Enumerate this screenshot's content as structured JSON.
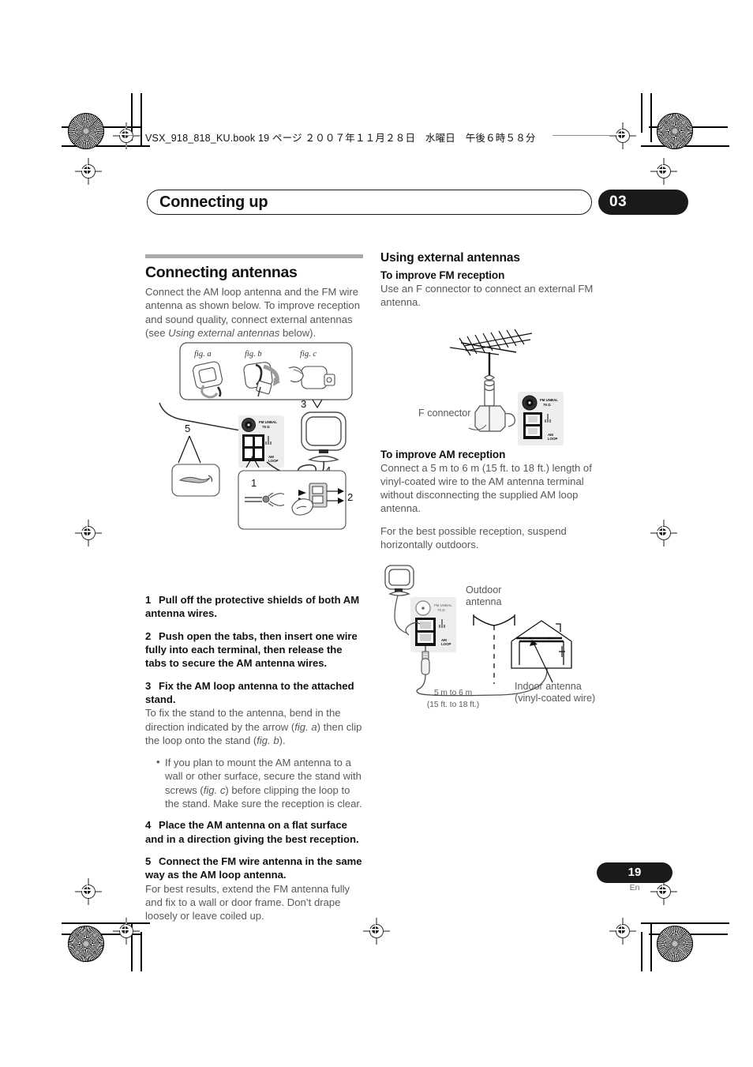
{
  "print": {
    "filename_line": "VSX_918_818_KU.book  19 ページ  ２００７年１１月２８日　水曜日　午後６時５８分"
  },
  "header": {
    "chapter_title": "Connecting up",
    "chapter_number": "03"
  },
  "left_column": {
    "section_title": "Connecting antennas",
    "intro_part1": "Connect the AM loop antenna and the FM wire antenna as shown below. To improve reception and sound quality, connect external antennas (see ",
    "intro_italic": "Using external antennas",
    "intro_part2": " below).",
    "steps": [
      {
        "num": "1",
        "text": "Pull off the protective shields of both AM antenna wires."
      },
      {
        "num": "2",
        "text": "Push open the tabs, then insert one wire fully into each terminal, then release the tabs to secure the AM antenna wires."
      },
      {
        "num": "3",
        "text": "Fix the AM loop antenna to the attached stand."
      },
      {
        "num": "4",
        "text": "Place the AM antenna on a flat surface and in a direction giving the best reception."
      },
      {
        "num": "5",
        "text": "Connect the FM wire antenna in the same way as the AM loop antenna."
      }
    ],
    "step3_body_a": "To fix the stand to the antenna, bend in the direction indicated by the arrow (",
    "step3_body_it1": "fig. a",
    "step3_body_b": ") then clip the loop onto the stand (",
    "step3_body_it2": "fig. b",
    "step3_body_c": ").",
    "bullet_a": "If you plan to mount the AM antenna to a wall or other surface, secure the stand with screws (",
    "bullet_it": "fig. c",
    "bullet_b": ") before clipping the loop to the stand. Make sure the reception is clear.",
    "step5_body": "For best results, extend the FM antenna fully and fix to a wall or door frame. Don’t drape loosely or leave coiled up."
  },
  "right_column": {
    "section_title": "Using external antennas",
    "fm_heading": "To improve FM reception",
    "fm_body": "Use an F connector to connect an external FM antenna.",
    "am_heading": "To improve AM reception",
    "am_body_1": "Connect a 5 m to 6 m (15 ft. to 18 ft.) length of vinyl-coated wire to the AM antenna terminal without disconnecting the supplied AM loop antenna.",
    "am_body_2": "For the best possible reception, suspend horizontally outdoors."
  },
  "figures": {
    "fig_box": {
      "label_a": "fig. a",
      "label_b": "fig. b",
      "label_c": "fig. c"
    },
    "main_diagram": {
      "callouts": [
        "1",
        "2",
        "3",
        "4",
        "5"
      ],
      "terminal_fm": "FM UNBAL",
      "terminal_fm_ohm": "75 Ω",
      "terminal_am": "AM",
      "terminal_am2": "LOOP"
    },
    "fm_diagram": {
      "f_connector_label": "F connector",
      "terminal_fm": "FM UNBAL",
      "terminal_fm_ohm": "75 Ω",
      "terminal_am": "AM",
      "terminal_am2": "LOOP"
    },
    "am_diagram": {
      "outdoor_label_1": "Outdoor",
      "outdoor_label_2": "antenna",
      "indoor_label_1": "Indoor antenna",
      "indoor_label_2": "(vinyl-coated wire)",
      "length_label_1": "5 m to 6 m",
      "length_label_2": "(15 ft. to 18 ft.)",
      "terminal_fm": "FM UNBAL",
      "terminal_fm_ohm": "75 Ω",
      "terminal_am": "AM",
      "terminal_am2": "LOOP"
    }
  },
  "footer": {
    "page_number": "19",
    "language": "En"
  },
  "colors": {
    "rule_gray": "#a7a9ac",
    "body_text": "#58585a",
    "heading": "#111111",
    "panel_gray": "#eceded",
    "black_pill": "#1a1a1a"
  }
}
